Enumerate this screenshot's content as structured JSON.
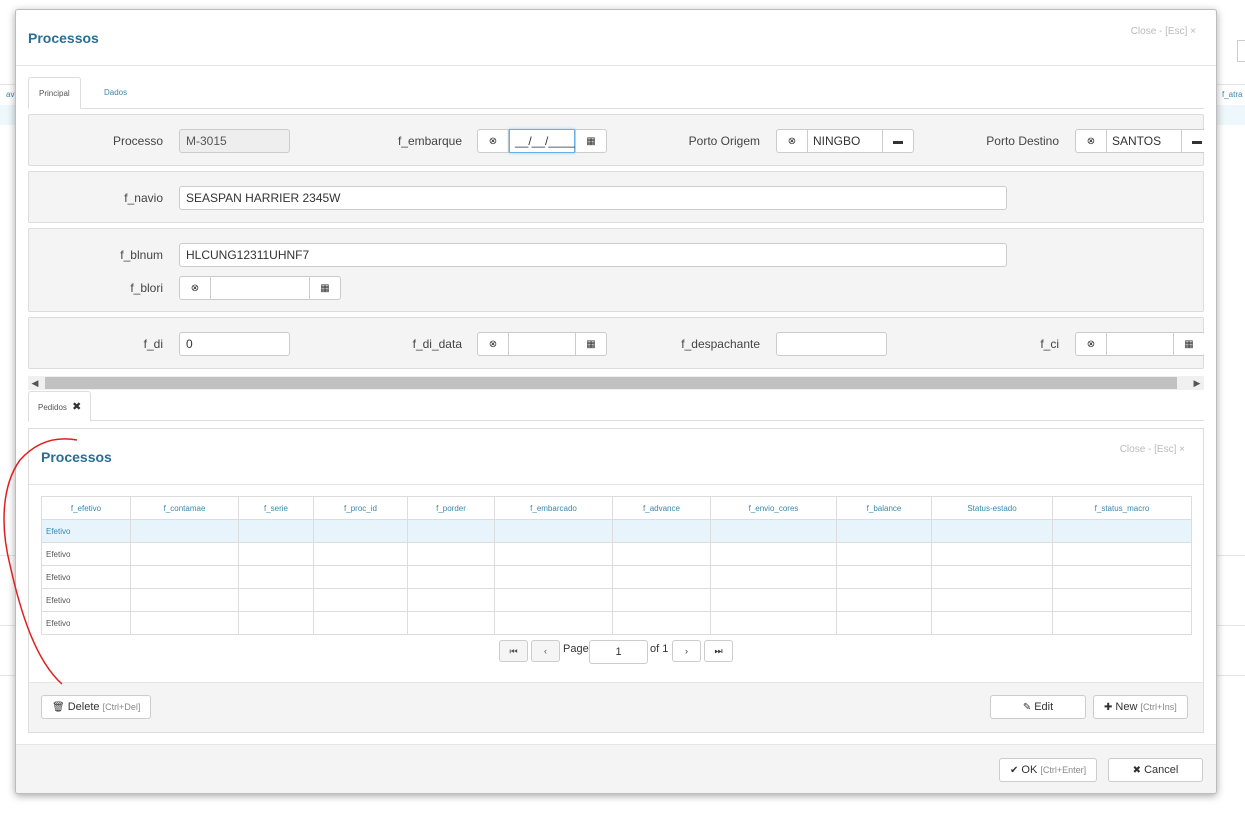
{
  "background": {
    "left_text": "avi",
    "right_text": "f_atra"
  },
  "modal": {
    "title": "Processos",
    "close_label": "Close - [Esc] ×",
    "tabs": [
      {
        "label": "Principal",
        "active": true
      },
      {
        "label": "Dados",
        "active": false
      }
    ]
  },
  "form": {
    "processo": {
      "label": "Processo",
      "value": "M-3015"
    },
    "f_embarque": {
      "label": "f_embarque",
      "value": "__/__/____"
    },
    "porto_origem": {
      "label": "Porto Origem",
      "value": "NINGBO"
    },
    "porto_destino": {
      "label": "Porto Destino",
      "value": "SANTOS"
    },
    "f_navio": {
      "label": "f_navio",
      "value": "SEASPAN HARRIER 2345W"
    },
    "f_blnum": {
      "label": "f_blnum",
      "value": "HLCUNG12311UHNF7"
    },
    "f_blori": {
      "label": "f_blori",
      "value": ""
    },
    "f_di": {
      "label": "f_di",
      "value": "0"
    },
    "f_di_data": {
      "label": "f_di_data",
      "value": ""
    },
    "f_despachante": {
      "label": "f_despachante",
      "value": ""
    },
    "f_ci": {
      "label": "f_ci",
      "value": ""
    }
  },
  "subtabs": [
    {
      "label": "Pedidos",
      "icon": "close-x-icon"
    }
  ],
  "sublist": {
    "title": "Processos",
    "close_label": "Close - [Esc] ×",
    "columns": [
      "f_efetivo",
      "f_contamae",
      "f_serie",
      "f_proc_id",
      "f_porder",
      "f_embarcado",
      "f_advance",
      "f_envio_cores",
      "f_balance",
      "Status-estado",
      "f_status_macro"
    ],
    "rows": [
      [
        "Efetivo",
        "",
        "",
        "",
        "",
        "",
        "",
        "",
        "",
        "",
        ""
      ],
      [
        "Efetivo",
        "",
        "",
        "",
        "",
        "",
        "",
        "",
        "",
        "",
        ""
      ],
      [
        "Efetivo",
        "",
        "",
        "",
        "",
        "",
        "",
        "",
        "",
        "",
        ""
      ],
      [
        "Efetivo",
        "",
        "",
        "",
        "",
        "",
        "",
        "",
        "",
        "",
        ""
      ],
      [
        "Efetivo",
        "",
        "",
        "",
        "",
        "",
        "",
        "",
        "",
        "",
        ""
      ]
    ],
    "selected_row": 0,
    "pager": {
      "page_label": "Page",
      "page_value": "1",
      "of_label": "of 1"
    },
    "buttons": {
      "delete": {
        "label": "Delete",
        "shortcut": "[Ctrl+Del]"
      },
      "edit": {
        "label": "Edit"
      },
      "new": {
        "label": "New",
        "shortcut": "[Ctrl+Ins]"
      }
    }
  },
  "footer": {
    "ok": {
      "label": "OK",
      "shortcut": "[Ctrl+Enter]"
    },
    "cancel": {
      "label": "Cancel"
    }
  },
  "colors": {
    "title_blue": "#2a6f93",
    "link_blue": "#3a87ad",
    "annotation_red": "#e02020"
  }
}
